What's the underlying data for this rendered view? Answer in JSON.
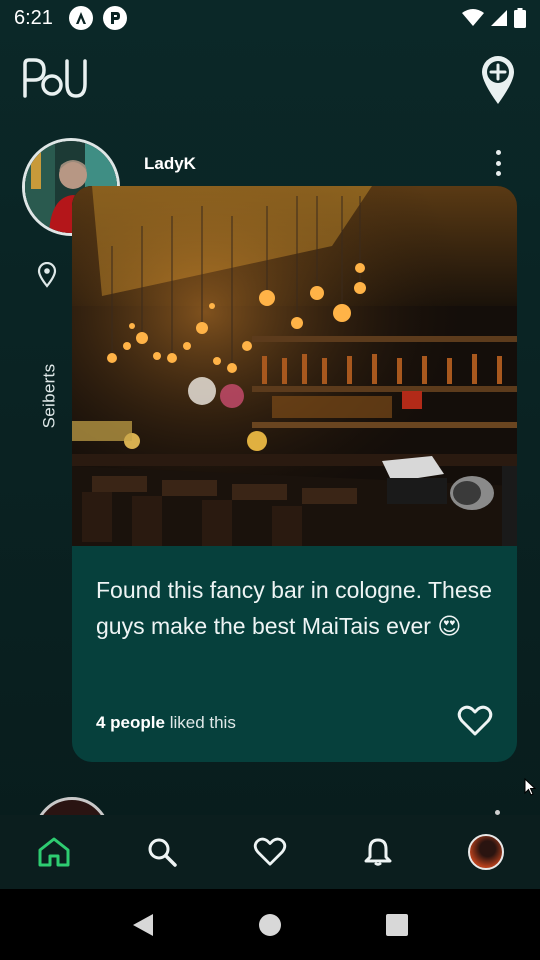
{
  "status_bar": {
    "time": "6:21"
  },
  "app": {
    "logo_text": "PoU"
  },
  "post": {
    "username": "LadyK",
    "location": "Seiberts",
    "caption": "Found this fancy bar in cologne. These guys make the best MaiTais ever 😍",
    "likes_bold": "4 people",
    "likes_rest": " liked this"
  },
  "colors": {
    "background": "#0a2323",
    "card": "#06403c",
    "accent": "#2ecc71",
    "bottom_nav": "#0b1e1e"
  },
  "icons": {
    "header": [
      "logo",
      "add-location-icon"
    ],
    "bottom_nav": [
      "home-icon",
      "search-icon",
      "heart-icon",
      "bell-icon",
      "profile-avatar"
    ],
    "system_nav": [
      "back-icon",
      "home-circle-icon",
      "recents-icon"
    ]
  },
  "bottom_nav": {
    "active": "home"
  }
}
